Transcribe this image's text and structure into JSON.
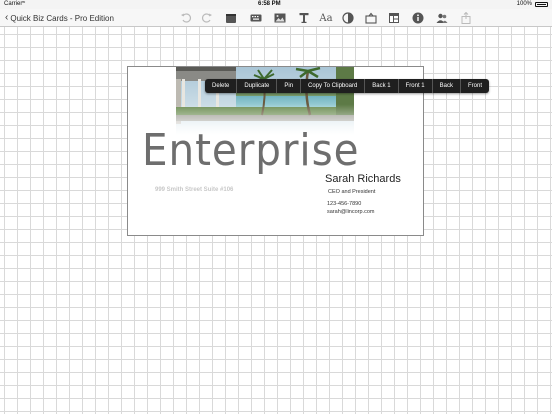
{
  "statusbar": {
    "carrier": "Carrier",
    "time": "6:58 PM",
    "battery": "100%"
  },
  "navbar": {
    "back_label": "Quick Biz Cards - Pro Edition",
    "tools": [
      "undo-icon",
      "redo-icon",
      "card-icon",
      "keyboard-icon",
      "image-icon",
      "text-tool-icon",
      "font-icon",
      "contrast-icon",
      "shapes-icon",
      "layout-icon",
      "info-icon",
      "share-people-icon",
      "export-icon"
    ]
  },
  "card": {
    "headline": "Enterprise",
    "address": "999 Smith Street Suite #106",
    "name": "Sarah Richards",
    "role": "CEO and President",
    "phone": "123-456-7890",
    "email": "sarah@lincorp.com"
  },
  "context_menu": {
    "items": [
      "Delete",
      "Duplicate",
      "Pin",
      "Copy To Clipboard",
      "Back 1",
      "Front 1",
      "Back",
      "Front"
    ]
  },
  "colors": {
    "menu_bg": "#1f1f1f",
    "grid_line": "#d9d9d9",
    "card_border": "#8a8a8a"
  }
}
